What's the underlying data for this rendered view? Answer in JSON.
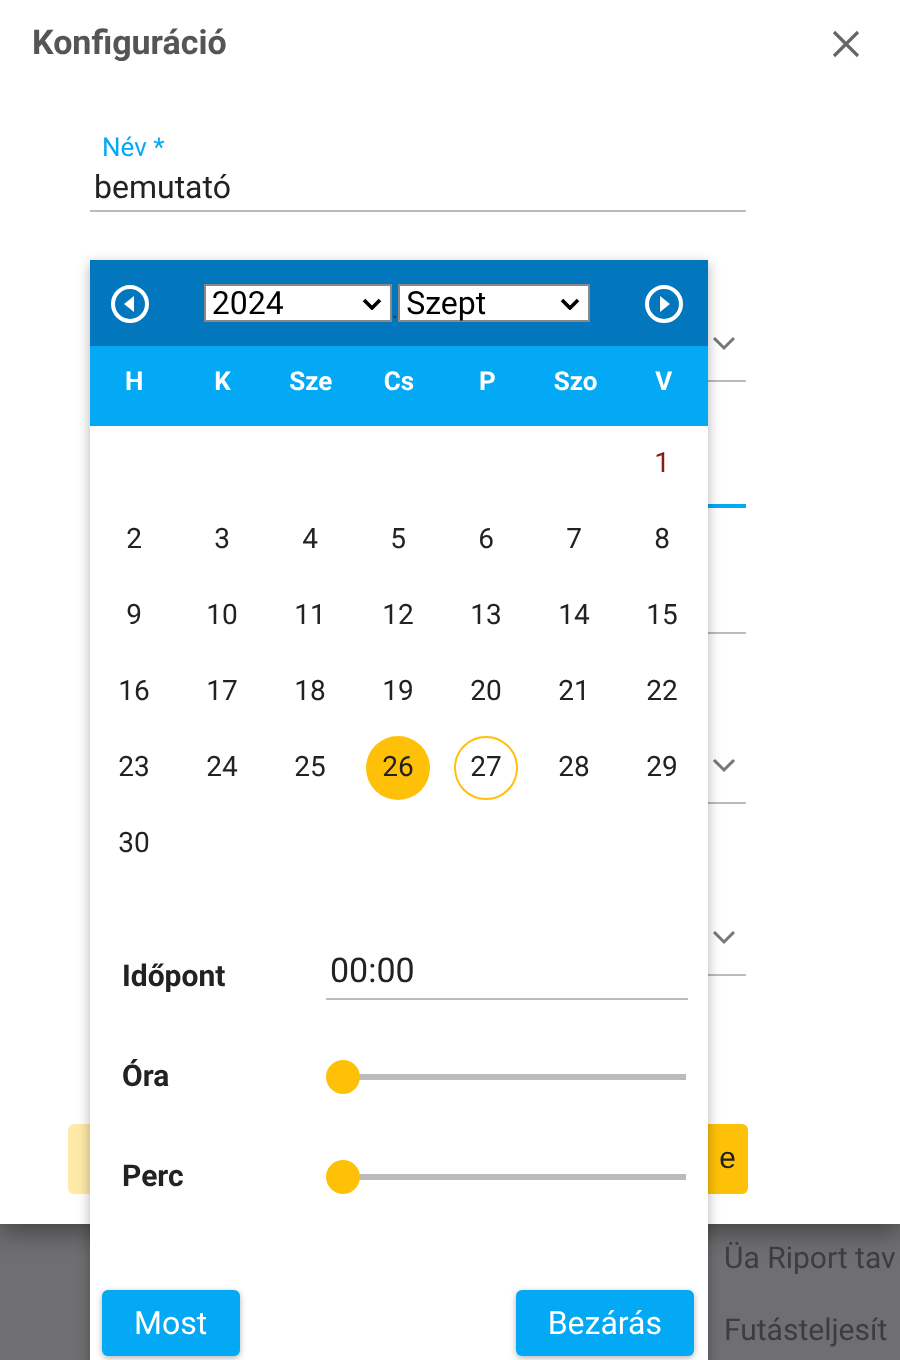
{
  "dialog": {
    "title": "Konfiguráció",
    "name_field": {
      "label": "Név *",
      "value": "bemutató"
    },
    "fields": [
      {
        "kind": "select",
        "focused": false
      },
      {
        "kind": "text",
        "focused": true
      },
      {
        "kind": "text",
        "focused": false
      },
      {
        "kind": "select",
        "focused": false
      },
      {
        "kind": "select",
        "focused": false
      }
    ],
    "buttons": [
      {
        "kind": "secondary"
      },
      {
        "kind": "primary",
        "label": "e"
      }
    ]
  },
  "behind": [
    "Üa Riport tav",
    "Futásteljesít"
  ],
  "datepicker": {
    "year": "2024",
    "separator": ".",
    "month": "Szept",
    "weekdays": [
      "H",
      "K",
      "Sze",
      "Cs",
      "P",
      "Szo",
      "V"
    ],
    "weeks": [
      [
        {
          "kind": "blank"
        },
        {
          "kind": "blank"
        },
        {
          "kind": "blank"
        },
        {
          "kind": "blank"
        },
        {
          "kind": "blank"
        },
        {
          "kind": "blank"
        },
        {
          "kind": "day",
          "day": "1",
          "selected": false,
          "today": false,
          "holiday": true
        }
      ],
      [
        {
          "day": "2",
          "selected": false,
          "today": false,
          "holiday": false
        },
        {
          "day": "3",
          "selected": false,
          "today": false,
          "holiday": false
        },
        {
          "day": "4",
          "selected": false,
          "today": false,
          "holiday": false
        },
        {
          "day": "5",
          "selected": false,
          "today": false,
          "holiday": false
        },
        {
          "day": "6",
          "selected": false,
          "today": false,
          "holiday": false
        },
        {
          "day": "7",
          "selected": false,
          "today": false,
          "holiday": false
        },
        {
          "day": "8",
          "selected": false,
          "today": false,
          "holiday": false
        }
      ],
      [
        {
          "day": "9",
          "selected": false,
          "today": false,
          "holiday": false
        },
        {
          "day": "10",
          "selected": false,
          "today": false,
          "holiday": false
        },
        {
          "day": "11",
          "selected": false,
          "today": false,
          "holiday": false
        },
        {
          "day": "12",
          "selected": false,
          "today": false,
          "holiday": false
        },
        {
          "day": "13",
          "selected": false,
          "today": false,
          "holiday": false
        },
        {
          "day": "14",
          "selected": false,
          "today": false,
          "holiday": false
        },
        {
          "day": "15",
          "selected": false,
          "today": false,
          "holiday": false
        }
      ],
      [
        {
          "day": "16",
          "selected": false,
          "today": false,
          "holiday": false
        },
        {
          "day": "17",
          "selected": false,
          "today": false,
          "holiday": false
        },
        {
          "day": "18",
          "selected": false,
          "today": false,
          "holiday": false
        },
        {
          "day": "19",
          "selected": false,
          "today": false,
          "holiday": false
        },
        {
          "day": "20",
          "selected": false,
          "today": false,
          "holiday": false
        },
        {
          "day": "21",
          "selected": false,
          "today": false,
          "holiday": false
        },
        {
          "day": "22",
          "selected": false,
          "today": false,
          "holiday": false
        }
      ],
      [
        {
          "day": "23",
          "selected": false,
          "today": false,
          "holiday": false
        },
        {
          "day": "24",
          "selected": false,
          "today": false,
          "holiday": false
        },
        {
          "day": "25",
          "selected": false,
          "today": false,
          "holiday": false
        },
        {
          "day": "26",
          "selected": true,
          "today": false,
          "holiday": false
        },
        {
          "day": "27",
          "selected": false,
          "today": true,
          "holiday": false
        },
        {
          "day": "28",
          "selected": false,
          "today": false,
          "holiday": false
        },
        {
          "day": "29",
          "selected": false,
          "today": false,
          "holiday": false
        }
      ],
      [
        {
          "kind": "day",
          "day": "30",
          "selected": false,
          "today": false,
          "holiday": false
        }
      ]
    ],
    "time": {
      "label": "Időpont",
      "value": "00:00"
    },
    "sliders": [
      {
        "label": "Óra",
        "level": 0
      },
      {
        "label": "Perc",
        "level": 0
      }
    ],
    "buttons": [
      "Most",
      "Bezárás"
    ]
  }
}
